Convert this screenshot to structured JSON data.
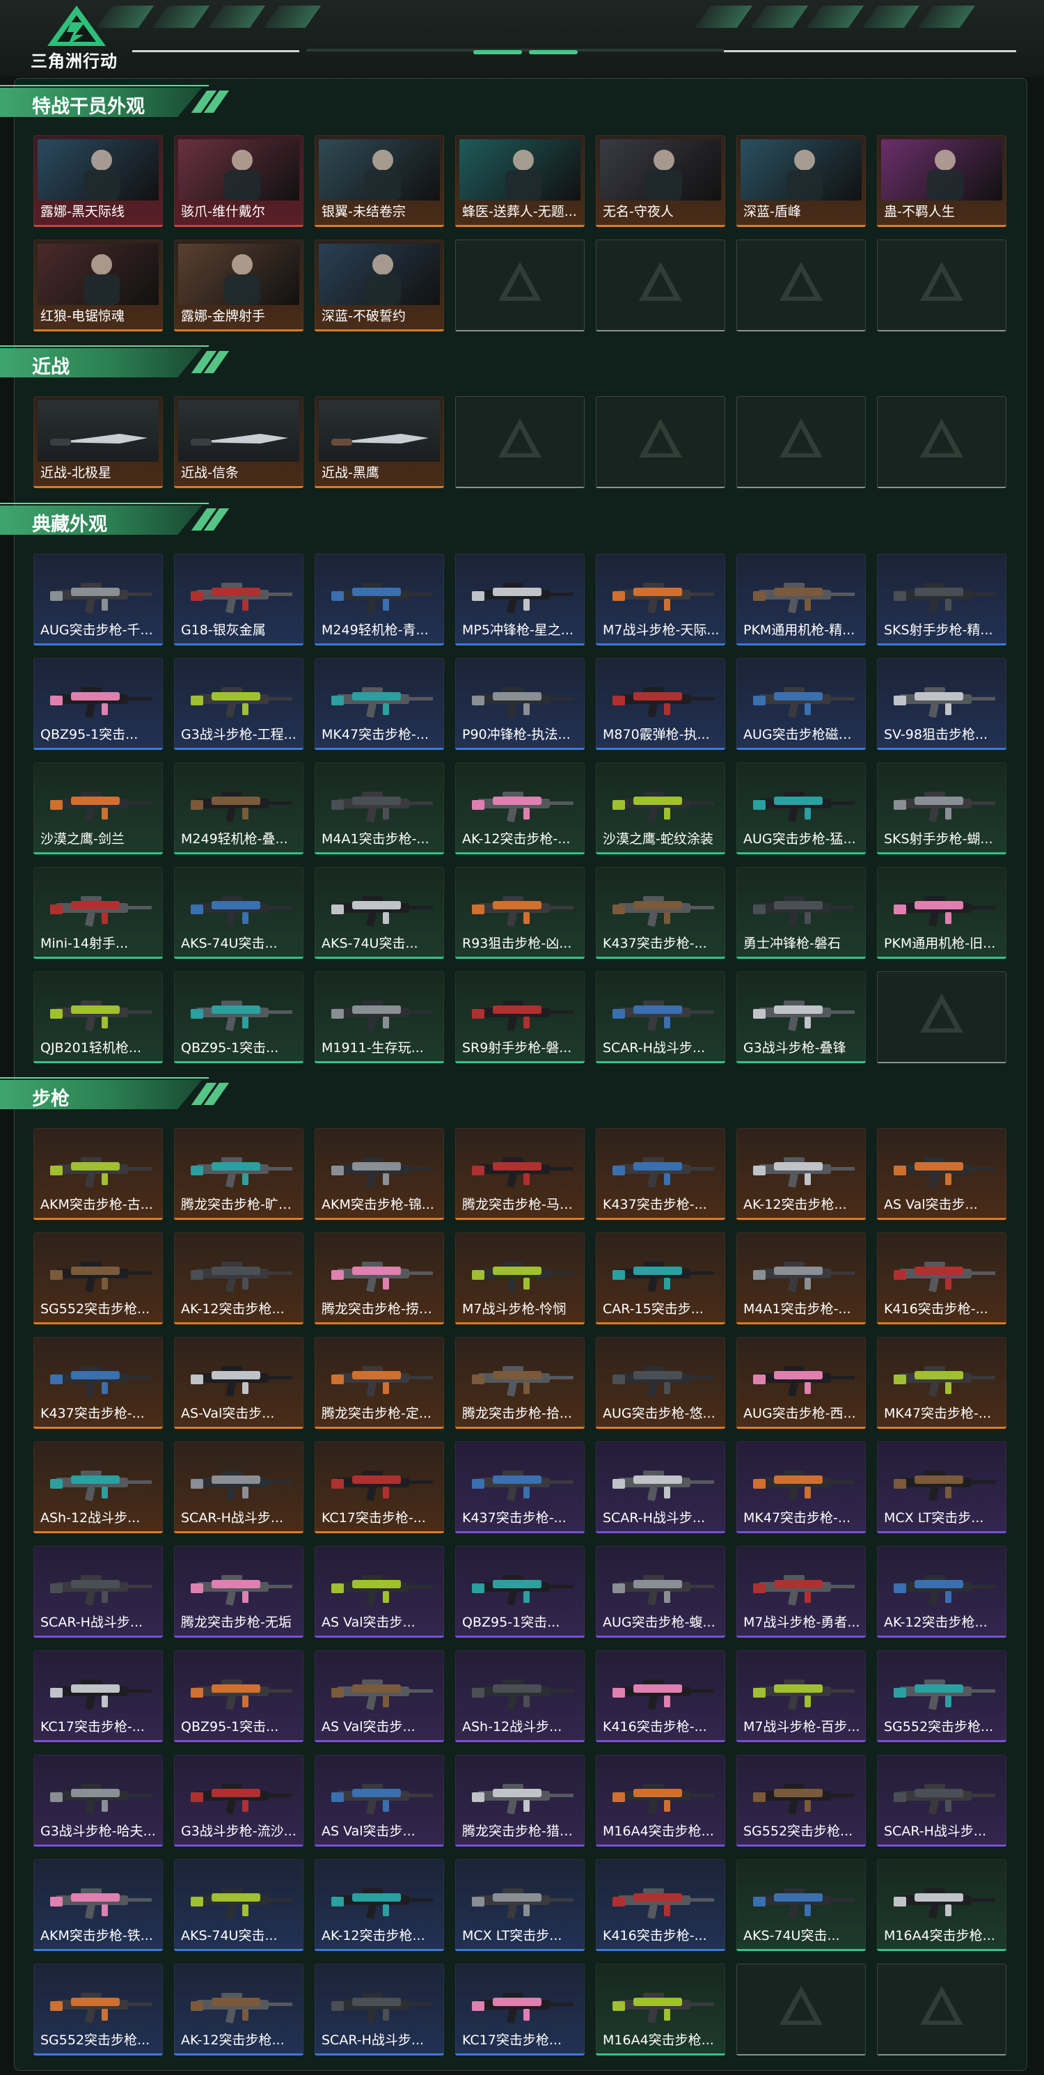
{
  "header": {
    "logo_text": "三角洲行动"
  },
  "theme": {
    "accent": "#3fa56e",
    "legendary_orange": "#e07a1f",
    "epic_purple": "#7a4fd6",
    "rare_blue": "#3b7bd6",
    "uncommon_green": "#34c28a",
    "empty_gray": "#8c9490"
  },
  "sections": {
    "operators": {
      "title": "特战干员外观",
      "items": [
        {
          "name": "露娜-黑天际线",
          "rarity": "red"
        },
        {
          "name": "骇爪-维什戴尔",
          "rarity": "red"
        },
        {
          "name": "银翼-未结卷宗",
          "rarity": "orange"
        },
        {
          "name": "蜂医-送葬人-无题...",
          "rarity": "orange"
        },
        {
          "name": "无名-守夜人",
          "rarity": "orange"
        },
        {
          "name": "深蓝-盾峰",
          "rarity": "orange"
        },
        {
          "name": "蛊-不羁人生",
          "rarity": "orange"
        },
        {
          "name": "红狼-电锯惊魂",
          "rarity": "orange"
        },
        {
          "name": "露娜-金牌射手",
          "rarity": "orange"
        },
        {
          "name": "深蓝-不破誓约",
          "rarity": "orange"
        }
      ],
      "empty_slots": 4
    },
    "melee": {
      "title": "近战",
      "items": [
        {
          "name": "近战-北极星",
          "rarity": "orange"
        },
        {
          "name": "近战-信条",
          "rarity": "orange"
        },
        {
          "name": "近战-黑鹰",
          "rarity": "orange"
        }
      ],
      "empty_slots": 4
    },
    "collection": {
      "title": "典藏外观",
      "items": [
        {
          "name": "AUG突击步枪-千...",
          "rarity": "blue"
        },
        {
          "name": "G18-银灰金属",
          "rarity": "blue"
        },
        {
          "name": "M249轻机枪-青...",
          "rarity": "blue"
        },
        {
          "name": "MP5冲锋枪-星之...",
          "rarity": "blue"
        },
        {
          "name": "M7战斗步枪-天际...",
          "rarity": "blue"
        },
        {
          "name": "PKM通用机枪-精...",
          "rarity": "blue"
        },
        {
          "name": "SKS射手步枪-精...",
          "rarity": "blue"
        },
        {
          "name": "QBZ95-1突击...",
          "rarity": "blue"
        },
        {
          "name": "G3战斗步枪-工程...",
          "rarity": "blue"
        },
        {
          "name": "MK47突击步枪-...",
          "rarity": "blue"
        },
        {
          "name": "P90冲锋枪-执法...",
          "rarity": "blue"
        },
        {
          "name": "M870霰弹枪-执...",
          "rarity": "blue"
        },
        {
          "name": "AUG突击步枪磁暴...",
          "rarity": "blue"
        },
        {
          "name": "SV-98狙击步枪...",
          "rarity": "blue"
        },
        {
          "name": "沙漠之鹰-剑兰",
          "rarity": "green"
        },
        {
          "name": "M249轻机枪-叠...",
          "rarity": "green"
        },
        {
          "name": "M4A1突击步枪-...",
          "rarity": "green"
        },
        {
          "name": "AK-12突击步枪-...",
          "rarity": "green"
        },
        {
          "name": "沙漠之鹰-蛇纹涂装",
          "rarity": "green"
        },
        {
          "name": "AUG突击步枪-猛...",
          "rarity": "green"
        },
        {
          "name": "SKS射手步枪-蝴...",
          "rarity": "green"
        },
        {
          "name": "Mini-14射手...",
          "rarity": "green"
        },
        {
          "name": "AKS-74U突击...",
          "rarity": "green"
        },
        {
          "name": "AKS-74U突击...",
          "rarity": "green"
        },
        {
          "name": "R93狙击步枪-凶...",
          "rarity": "green"
        },
        {
          "name": "K437突击步枪-...",
          "rarity": "green"
        },
        {
          "name": "勇士冲锋枪-磐石",
          "rarity": "green"
        },
        {
          "name": "PKM通用机枪-旧...",
          "rarity": "green"
        },
        {
          "name": "QJB201轻机枪...",
          "rarity": "green"
        },
        {
          "name": "QBZ95-1突击...",
          "rarity": "green"
        },
        {
          "name": "M1911-生存玩...",
          "rarity": "green"
        },
        {
          "name": "SR9射手步枪-磐...",
          "rarity": "green"
        },
        {
          "name": "SCAR-H战斗步...",
          "rarity": "green"
        },
        {
          "name": "G3战斗步枪-叠锋",
          "rarity": "green"
        }
      ],
      "empty_slots": 1
    },
    "rifles": {
      "title": "步枪",
      "items": [
        {
          "name": "AKM突击步枪-古...",
          "rarity": "orange"
        },
        {
          "name": "腾龙突击步枪-旷野...",
          "rarity": "orange"
        },
        {
          "name": "AKM突击步枪-锦...",
          "rarity": "orange"
        },
        {
          "name": "腾龙突击步枪-马年...",
          "rarity": "orange"
        },
        {
          "name": "K437突击步枪-...",
          "rarity": "orange"
        },
        {
          "name": "AK-12突击步枪...",
          "rarity": "orange"
        },
        {
          "name": "AS Val突击步...",
          "rarity": "orange"
        },
        {
          "name": "SG552突击步枪...",
          "rarity": "orange"
        },
        {
          "name": "AK-12突击步枪...",
          "rarity": "orange"
        },
        {
          "name": "腾龙突击步枪-捞点...",
          "rarity": "orange"
        },
        {
          "name": "M7战斗步枪-怜悯",
          "rarity": "orange"
        },
        {
          "name": "CAR-15突击步...",
          "rarity": "orange"
        },
        {
          "name": "M4A1突击步枪-...",
          "rarity": "orange"
        },
        {
          "name": "K416突击步枪-...",
          "rarity": "orange"
        },
        {
          "name": "K437突击步枪-...",
          "rarity": "orange"
        },
        {
          "name": "AS-Val突击步...",
          "rarity": "orange"
        },
        {
          "name": "腾龙突击步枪-定...",
          "rarity": "orange"
        },
        {
          "name": "腾龙突击步枪-拾...",
          "rarity": "orange"
        },
        {
          "name": "AUG突击步枪-悠...",
          "rarity": "orange"
        },
        {
          "name": "AUG突击步枪-西...",
          "rarity": "orange"
        },
        {
          "name": "MK47突击步枪-...",
          "rarity": "orange"
        },
        {
          "name": "ASh-12战斗步...",
          "rarity": "orange"
        },
        {
          "name": "SCAR-H战斗步...",
          "rarity": "orange"
        },
        {
          "name": "KC17突击步枪-...",
          "rarity": "orange"
        },
        {
          "name": "K437突击步枪-...",
          "rarity": "purple"
        },
        {
          "name": "SCAR-H战斗步...",
          "rarity": "purple"
        },
        {
          "name": "MK47突击步枪-...",
          "rarity": "purple"
        },
        {
          "name": "MCX LT突击步...",
          "rarity": "purple"
        },
        {
          "name": "SCAR-H战斗步...",
          "rarity": "purple"
        },
        {
          "name": "腾龙突击步枪-无垢",
          "rarity": "purple"
        },
        {
          "name": "AS Val突击步...",
          "rarity": "purple"
        },
        {
          "name": "QBZ95-1突击...",
          "rarity": "purple"
        },
        {
          "name": "AUG突击步枪-蝮...",
          "rarity": "purple"
        },
        {
          "name": "M7战斗步枪-勇者...",
          "rarity": "purple"
        },
        {
          "name": "AK-12突击步枪...",
          "rarity": "purple"
        },
        {
          "name": "KC17突击步枪-...",
          "rarity": "purple"
        },
        {
          "name": "QBZ95-1突击...",
          "rarity": "purple"
        },
        {
          "name": "AS Val突击步...",
          "rarity": "purple"
        },
        {
          "name": "ASh-12战斗步...",
          "rarity": "purple"
        },
        {
          "name": "K416突击步枪-...",
          "rarity": "purple"
        },
        {
          "name": "M7战斗步枪-百步...",
          "rarity": "purple"
        },
        {
          "name": "SG552突击步枪...",
          "rarity": "purple"
        },
        {
          "name": "G3战斗步枪-哈夫...",
          "rarity": "purple"
        },
        {
          "name": "G3战斗步枪-流沙...",
          "rarity": "purple"
        },
        {
          "name": "AS Val突击步...",
          "rarity": "purple"
        },
        {
          "name": "腾龙突击步枪-猎鳄...",
          "rarity": "purple"
        },
        {
          "name": "M16A4突击步枪...",
          "rarity": "purple"
        },
        {
          "name": "SG552突击步枪...",
          "rarity": "purple"
        },
        {
          "name": "SCAR-H战斗步...",
          "rarity": "purple"
        },
        {
          "name": "AKM突击步枪-铁...",
          "rarity": "blue"
        },
        {
          "name": "AKS-74U突击...",
          "rarity": "blue"
        },
        {
          "name": "AK-12突击步枪...",
          "rarity": "blue"
        },
        {
          "name": "MCX LT突击步...",
          "rarity": "blue"
        },
        {
          "name": "K416突击步枪-...",
          "rarity": "blue"
        },
        {
          "name": "AKS-74U突击...",
          "rarity": "green"
        },
        {
          "name": "M16A4突击步枪...",
          "rarity": "green"
        },
        {
          "name": "SG552突击步枪...",
          "rarity": "blue"
        },
        {
          "name": "AK-12突击步枪...",
          "rarity": "blue"
        },
        {
          "name": "SCAR-H战斗步...",
          "rarity": "blue"
        },
        {
          "name": "KC17突击步枪...",
          "rarity": "blue"
        },
        {
          "name": "M16A4突击步枪...",
          "rarity": "green"
        }
      ],
      "empty_slots": 2
    }
  }
}
